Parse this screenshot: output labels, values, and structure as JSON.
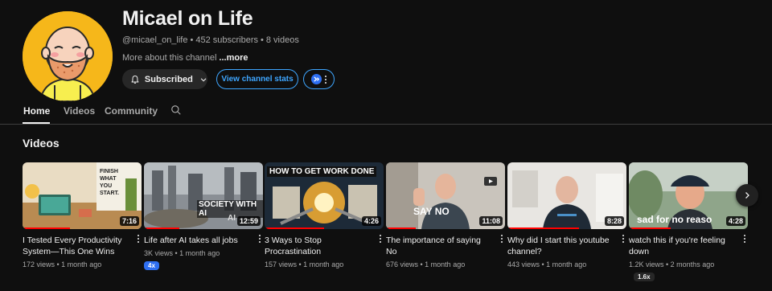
{
  "channel": {
    "name": "Micael on Life",
    "handle": "@micael_on_life",
    "subscribers": "452 subscribers",
    "videos_count": "8 videos",
    "about": "More about this channel",
    "more": "...more",
    "avatar_bg": "#f6b71a"
  },
  "actions": {
    "subscribed_label": "Subscribed",
    "stats_label": "View channel stats"
  },
  "tabs": [
    {
      "label": "Home",
      "active": true
    },
    {
      "label": "Videos",
      "active": false
    },
    {
      "label": "Community",
      "active": false
    }
  ],
  "section": {
    "title": "Videos"
  },
  "videos": [
    {
      "title": "I Tested Every Productivity System—This One Wins",
      "duration": "7:16",
      "meta": "172 views • 1 month ago",
      "thumb_text": [
        "FINISH",
        "WHAT",
        "YOU",
        "START."
      ],
      "progress": 0.4
    },
    {
      "title": "Life after AI takes all jobs",
      "duration": "12:59",
      "meta": "3K views • 1 month ago",
      "badge": "4x",
      "thumb_text": [
        "SOCIETY WITH AI",
        "AI"
      ],
      "progress": 0.3
    },
    {
      "title": "3 Ways to Stop Procrastination",
      "duration": "4:26",
      "meta": "157 views • 1 month ago",
      "thumb_text": [
        "HOW TO GET WORK DONE"
      ],
      "progress": 0.5
    },
    {
      "title": "The importance of saying No",
      "duration": "11:08",
      "meta": "676 views • 1 month ago",
      "thumb_text": [
        "SAY NO"
      ],
      "progress": 0.25
    },
    {
      "title": "Why did I start this youtube channel?",
      "duration": "8:28",
      "meta": "443 views • 1 month ago",
      "thumb_text": [],
      "progress": 0.6
    },
    {
      "title": "watch this if you're feeling down",
      "duration": "4:28",
      "meta": "1.2K views • 2 months ago",
      "badge": "1.6x",
      "thumb_text": [
        "sad for no reaso"
      ],
      "progress": 0.35
    }
  ],
  "colors": {
    "accent_blue": "#3ea6ff",
    "progress_red": "#ff0000",
    "background": "#0f0f0f"
  },
  "icons": {
    "bell": "bell-icon",
    "chevron": "chevron-down-icon",
    "search": "search-icon",
    "next": "chevron-right-icon",
    "more": "more-vertical-icon"
  }
}
